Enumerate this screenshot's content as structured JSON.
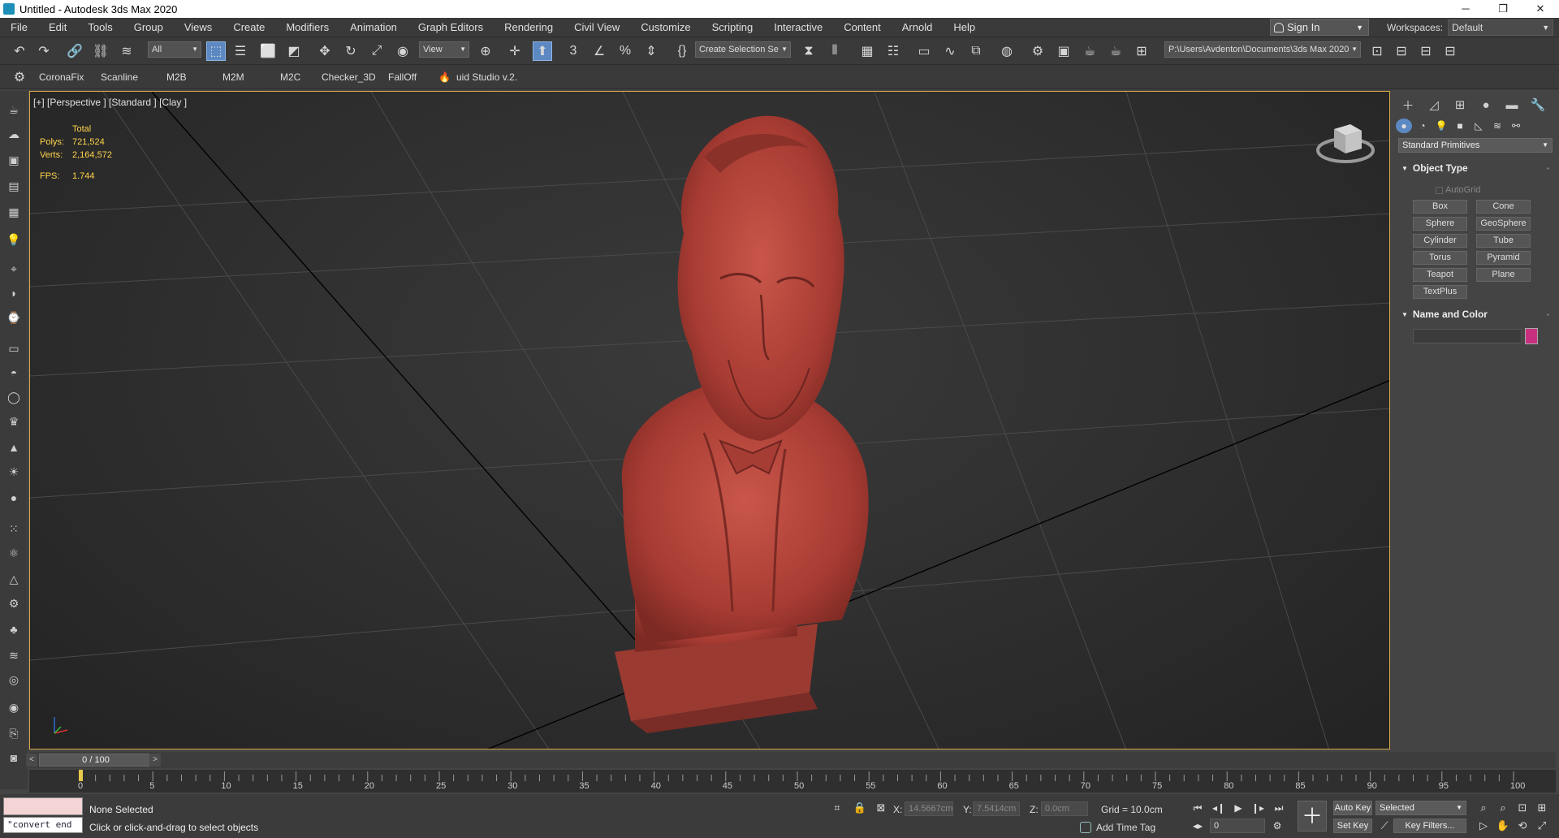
{
  "window": {
    "title": "Untitled - Autodesk 3ds Max 2020",
    "controls": [
      "─",
      "❐",
      "✕"
    ]
  },
  "menubar": {
    "items": [
      "File",
      "Edit",
      "Tools",
      "Group",
      "Views",
      "Create",
      "Modifiers",
      "Animation",
      "Graph Editors",
      "Rendering",
      "Civil View",
      "Customize",
      "Scripting",
      "Interactive",
      "Content",
      "Arnold",
      "Help"
    ],
    "sign_in": "Sign In",
    "workspaces_label": "Workspaces:",
    "workspace_value": "Default"
  },
  "toolbar": {
    "selection_filter": "All",
    "ref_coord": "View",
    "named_selection": "Create Selection Se",
    "project_path": "P:\\Users\\Avdenton\\Documents\\3ds Max 2020"
  },
  "shelf": {
    "items": [
      "CoronaFix",
      "Scanline",
      "M2B",
      "M2M",
      "M2C",
      "Checker_3D",
      "FallOff",
      "uid Studio v.2."
    ]
  },
  "viewport": {
    "label": "[+] [Perspective ] [Standard ] [Clay ]",
    "stats": {
      "header": "Total",
      "polys_label": "Polys:",
      "polys": "721,524",
      "verts_label": "Verts:",
      "verts": "2,164,572",
      "fps_label": "FPS:",
      "fps": "1.744"
    },
    "object_color": "#c0463c"
  },
  "command_panel": {
    "category": "Standard Primitives",
    "object_type_title": "Object Type",
    "autogrid": "AutoGrid",
    "buttons": [
      "Box",
      "Cone",
      "Sphere",
      "GeoSphere",
      "Cylinder",
      "Tube",
      "Torus",
      "Pyramid",
      "Teapot",
      "Plane",
      "TextPlus"
    ],
    "name_color_title": "Name and Color",
    "swatch_color": "#c8307f"
  },
  "timeline": {
    "frame_display": "0 / 100",
    "prev": "<",
    "next": ">",
    "ticks": [
      "0",
      "5",
      "10",
      "15",
      "20",
      "25",
      "30",
      "35",
      "40",
      "45",
      "50",
      "55",
      "60",
      "65",
      "70",
      "75",
      "80",
      "85",
      "90",
      "95",
      "100"
    ]
  },
  "status": {
    "maxscript_output": "\"convert end",
    "selection": "None Selected",
    "prompt": "Click or click-and-drag to select objects",
    "x_label": "X:",
    "x_value": "14.5667cm",
    "y_label": "Y:",
    "y_value": "7.5414cm",
    "z_label": "Z:",
    "z_value": "0.0cm",
    "grid": "Grid = 10.0cm",
    "add_time_tag": "Add Time Tag",
    "frame": "0",
    "auto_key": "Auto Key",
    "set_key": "Set Key",
    "key_set": "Selected",
    "key_filters": "Key Filters..."
  }
}
